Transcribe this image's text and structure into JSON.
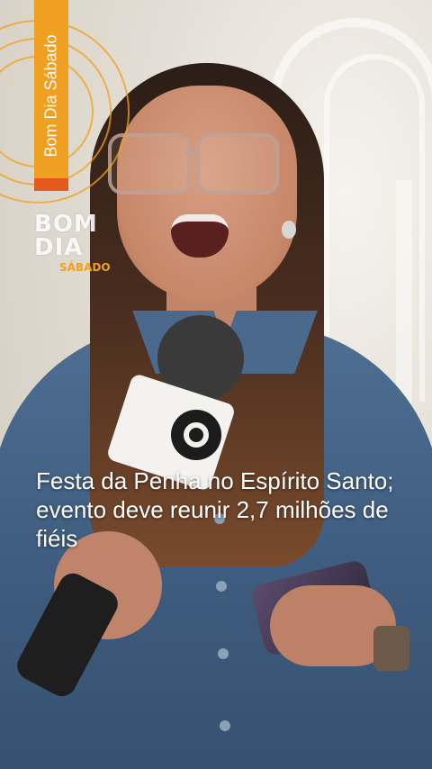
{
  "branding": {
    "vertical_label": "Bom Dia Sábado",
    "logo_line1": "BOM",
    "logo_line2": "DIA",
    "logo_sub": "SÁBADO",
    "accent_color": "#f0a020",
    "accent_secondary": "#e35a1c"
  },
  "caption": {
    "text": "Festa da Penha no Espírito Santo; evento deve reunir 2,7 milhões de fiéis"
  },
  "icons": {
    "broadcaster_logo": "globo-icon"
  }
}
